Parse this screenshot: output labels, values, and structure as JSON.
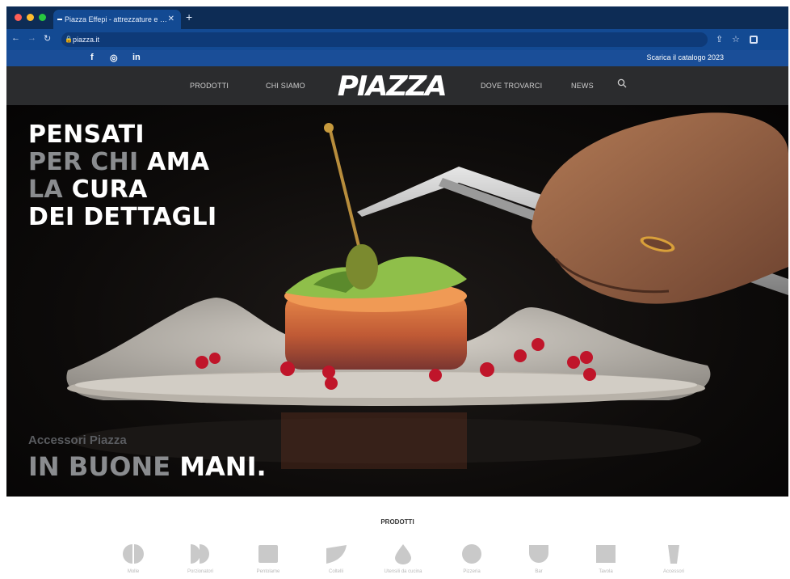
{
  "browser": {
    "tab_title": "Piazza Effepi - attrezzature e …",
    "url": "piazza.it"
  },
  "site": {
    "top_bar": {
      "social": [
        "f",
        "◎",
        "in"
      ],
      "catalog_link": "Scarica il catalogo 2023"
    },
    "nav": {
      "left": [
        "PRODOTTI",
        "CHI SIAMO"
      ],
      "logo": "PIAZZA",
      "right": [
        "DOVE TROVARCI",
        "NEWS"
      ]
    },
    "hero": {
      "line1": "PENSATI",
      "line2_grey": "PER CHI",
      "line2_white": "AMA",
      "line3_grey": "LA",
      "line3_white": "CURA",
      "line4": "DEI DETTAGLI",
      "subtitle": "Accessori Piazza",
      "tagline_grey": "IN BUONE",
      "tagline_white": "MANI."
    },
    "products": {
      "title": "PRODOTTI",
      "items": [
        "Molle",
        "Porzionatori",
        "Pentolame",
        "Coltelli",
        "Utensili da cucina",
        "Pizzeria",
        "Bar",
        "Tavola",
        "Accessori"
      ]
    }
  },
  "colors": {
    "tabstrip": "#0d2c55",
    "toolbar": "#134a93",
    "topbar": "#1a4e98",
    "nav": "#2b2c2e",
    "hero_grey": "#8a8c8f"
  }
}
